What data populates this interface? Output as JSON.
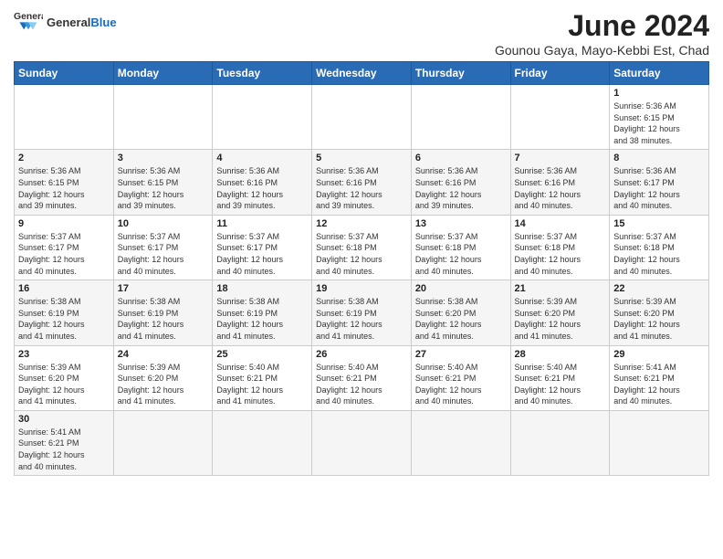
{
  "header": {
    "logo_general": "General",
    "logo_blue": "Blue",
    "month_year": "June 2024",
    "location": "Gounou Gaya, Mayo-Kebbi Est, Chad"
  },
  "days_of_week": [
    "Sunday",
    "Monday",
    "Tuesday",
    "Wednesday",
    "Thursday",
    "Friday",
    "Saturday"
  ],
  "weeks": [
    [
      {
        "day": "",
        "info": ""
      },
      {
        "day": "",
        "info": ""
      },
      {
        "day": "",
        "info": ""
      },
      {
        "day": "",
        "info": ""
      },
      {
        "day": "",
        "info": ""
      },
      {
        "day": "",
        "info": ""
      },
      {
        "day": "1",
        "info": "Sunrise: 5:36 AM\nSunset: 6:15 PM\nDaylight: 12 hours\nand 38 minutes."
      }
    ],
    [
      {
        "day": "2",
        "info": "Sunrise: 5:36 AM\nSunset: 6:15 PM\nDaylight: 12 hours\nand 39 minutes."
      },
      {
        "day": "3",
        "info": "Sunrise: 5:36 AM\nSunset: 6:15 PM\nDaylight: 12 hours\nand 39 minutes."
      },
      {
        "day": "4",
        "info": "Sunrise: 5:36 AM\nSunset: 6:16 PM\nDaylight: 12 hours\nand 39 minutes."
      },
      {
        "day": "5",
        "info": "Sunrise: 5:36 AM\nSunset: 6:16 PM\nDaylight: 12 hours\nand 39 minutes."
      },
      {
        "day": "6",
        "info": "Sunrise: 5:36 AM\nSunset: 6:16 PM\nDaylight: 12 hours\nand 39 minutes."
      },
      {
        "day": "7",
        "info": "Sunrise: 5:36 AM\nSunset: 6:16 PM\nDaylight: 12 hours\nand 40 minutes."
      },
      {
        "day": "8",
        "info": "Sunrise: 5:36 AM\nSunset: 6:17 PM\nDaylight: 12 hours\nand 40 minutes."
      }
    ],
    [
      {
        "day": "9",
        "info": "Sunrise: 5:37 AM\nSunset: 6:17 PM\nDaylight: 12 hours\nand 40 minutes."
      },
      {
        "day": "10",
        "info": "Sunrise: 5:37 AM\nSunset: 6:17 PM\nDaylight: 12 hours\nand 40 minutes."
      },
      {
        "day": "11",
        "info": "Sunrise: 5:37 AM\nSunset: 6:17 PM\nDaylight: 12 hours\nand 40 minutes."
      },
      {
        "day": "12",
        "info": "Sunrise: 5:37 AM\nSunset: 6:18 PM\nDaylight: 12 hours\nand 40 minutes."
      },
      {
        "day": "13",
        "info": "Sunrise: 5:37 AM\nSunset: 6:18 PM\nDaylight: 12 hours\nand 40 minutes."
      },
      {
        "day": "14",
        "info": "Sunrise: 5:37 AM\nSunset: 6:18 PM\nDaylight: 12 hours\nand 40 minutes."
      },
      {
        "day": "15",
        "info": "Sunrise: 5:37 AM\nSunset: 6:18 PM\nDaylight: 12 hours\nand 40 minutes."
      }
    ],
    [
      {
        "day": "16",
        "info": "Sunrise: 5:38 AM\nSunset: 6:19 PM\nDaylight: 12 hours\nand 41 minutes."
      },
      {
        "day": "17",
        "info": "Sunrise: 5:38 AM\nSunset: 6:19 PM\nDaylight: 12 hours\nand 41 minutes."
      },
      {
        "day": "18",
        "info": "Sunrise: 5:38 AM\nSunset: 6:19 PM\nDaylight: 12 hours\nand 41 minutes."
      },
      {
        "day": "19",
        "info": "Sunrise: 5:38 AM\nSunset: 6:19 PM\nDaylight: 12 hours\nand 41 minutes."
      },
      {
        "day": "20",
        "info": "Sunrise: 5:38 AM\nSunset: 6:20 PM\nDaylight: 12 hours\nand 41 minutes."
      },
      {
        "day": "21",
        "info": "Sunrise: 5:39 AM\nSunset: 6:20 PM\nDaylight: 12 hours\nand 41 minutes."
      },
      {
        "day": "22",
        "info": "Sunrise: 5:39 AM\nSunset: 6:20 PM\nDaylight: 12 hours\nand 41 minutes."
      }
    ],
    [
      {
        "day": "23",
        "info": "Sunrise: 5:39 AM\nSunset: 6:20 PM\nDaylight: 12 hours\nand 41 minutes."
      },
      {
        "day": "24",
        "info": "Sunrise: 5:39 AM\nSunset: 6:20 PM\nDaylight: 12 hours\nand 41 minutes."
      },
      {
        "day": "25",
        "info": "Sunrise: 5:40 AM\nSunset: 6:21 PM\nDaylight: 12 hours\nand 41 minutes."
      },
      {
        "day": "26",
        "info": "Sunrise: 5:40 AM\nSunset: 6:21 PM\nDaylight: 12 hours\nand 40 minutes."
      },
      {
        "day": "27",
        "info": "Sunrise: 5:40 AM\nSunset: 6:21 PM\nDaylight: 12 hours\nand 40 minutes."
      },
      {
        "day": "28",
        "info": "Sunrise: 5:40 AM\nSunset: 6:21 PM\nDaylight: 12 hours\nand 40 minutes."
      },
      {
        "day": "29",
        "info": "Sunrise: 5:41 AM\nSunset: 6:21 PM\nDaylight: 12 hours\nand 40 minutes."
      }
    ],
    [
      {
        "day": "30",
        "info": "Sunrise: 5:41 AM\nSunset: 6:21 PM\nDaylight: 12 hours\nand 40 minutes."
      },
      {
        "day": "",
        "info": ""
      },
      {
        "day": "",
        "info": ""
      },
      {
        "day": "",
        "info": ""
      },
      {
        "day": "",
        "info": ""
      },
      {
        "day": "",
        "info": ""
      },
      {
        "day": "",
        "info": ""
      }
    ]
  ]
}
